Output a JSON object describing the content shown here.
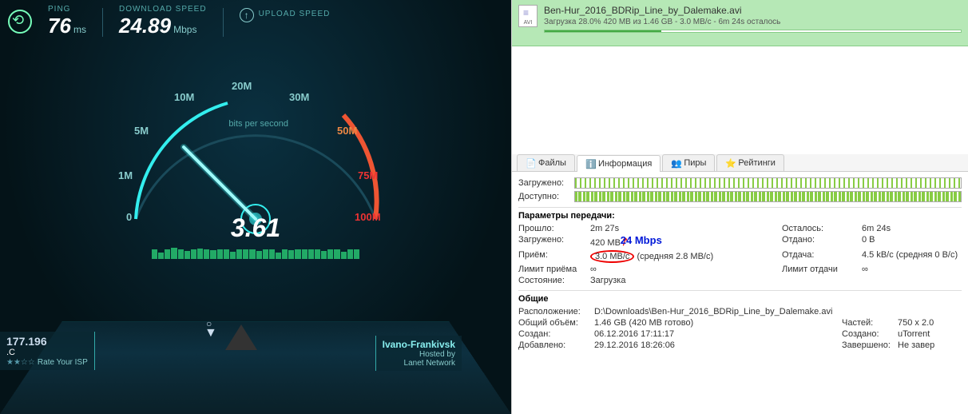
{
  "speedtest": {
    "ping": {
      "label": "PING",
      "value": "76",
      "unit": "ms"
    },
    "download": {
      "label": "DOWNLOAD SPEED",
      "value": "24.89",
      "unit": "Mbps"
    },
    "upload": {
      "label": "UPLOAD SPEED"
    },
    "ticks": {
      "t0": "0",
      "t1m": "1M",
      "t5m": "5M",
      "t10m": "10M",
      "t20m": "20M",
      "t30m": "30M",
      "t50m": "50M",
      "t75m": "75M",
      "t100m": "100M"
    },
    "bits_label": "bits per second",
    "current_value": "3.61",
    "ip": "177.196",
    "isp_suffix": ".C",
    "rate_isp": "Rate Your ISP",
    "server_city": "Ivano-Frankivsk",
    "hosted_by": "Hosted by",
    "server_host": "Lanet Network"
  },
  "torrent": {
    "file": {
      "icon_label": "AVI",
      "name": "Ben-Hur_2016_BDRip_Line_by_Dalemake.avi",
      "status": "Загрузка 28.0% 420 MB из 1.46 GB - 3.0 MB/с - 6m 24s осталось",
      "progress_percent": 28
    },
    "tabs": {
      "files": "Файлы",
      "info": "Информация",
      "peers": "Пиры",
      "ratings": "Рейтинги"
    },
    "bars": {
      "downloaded": "Загружено:",
      "available": "Доступно:"
    },
    "params_header": "Параметры передачи:",
    "params": {
      "elapsed_l": "Прошло:",
      "elapsed_v": "2m 27s",
      "remaining_l": "Осталось:",
      "remaining_v": "6m 24s",
      "downloaded_l": "Загружено:",
      "downloaded_v": "420 MB",
      "uploaded_l": "Отдано:",
      "uploaded_v": "0 B",
      "recv_l": "Приём:",
      "recv_v": "3.0 MB/с",
      "recv_avg": "(средняя 2.8 MB/с)",
      "send_l": "Отдача:",
      "send_v": "4.5 kB/с (средняя 0 B/с)",
      "dllimit_l": "Лимит приёма",
      "dllimit_v": "∞",
      "ullimit_l": "Лимит отдачи",
      "ullimit_v": "∞",
      "state_l": "Состояние:",
      "state_v": "Загрузка",
      "annotation": "24 Mbps"
    },
    "common_header": "Общие",
    "common": {
      "location_l": "Расположение:",
      "location_v": "D:\\Downloads\\Ben-Hur_2016_BDRip_Line_by_Dalemake.avi",
      "size_l": "Общий объём:",
      "size_v": "1.46 GB (420 MB готово)",
      "pieces_l": "Частей:",
      "pieces_v": "750 x 2.0",
      "created_l": "Создан:",
      "created_v": "06.12.2016 17:11:17",
      "createdby_l": "Создано:",
      "createdby_v": "uTorrent",
      "added_l": "Добавлено:",
      "added_v": "29.12.2016 18:26:06",
      "completed_l": "Завершено:",
      "completed_v": "Не завер"
    }
  }
}
